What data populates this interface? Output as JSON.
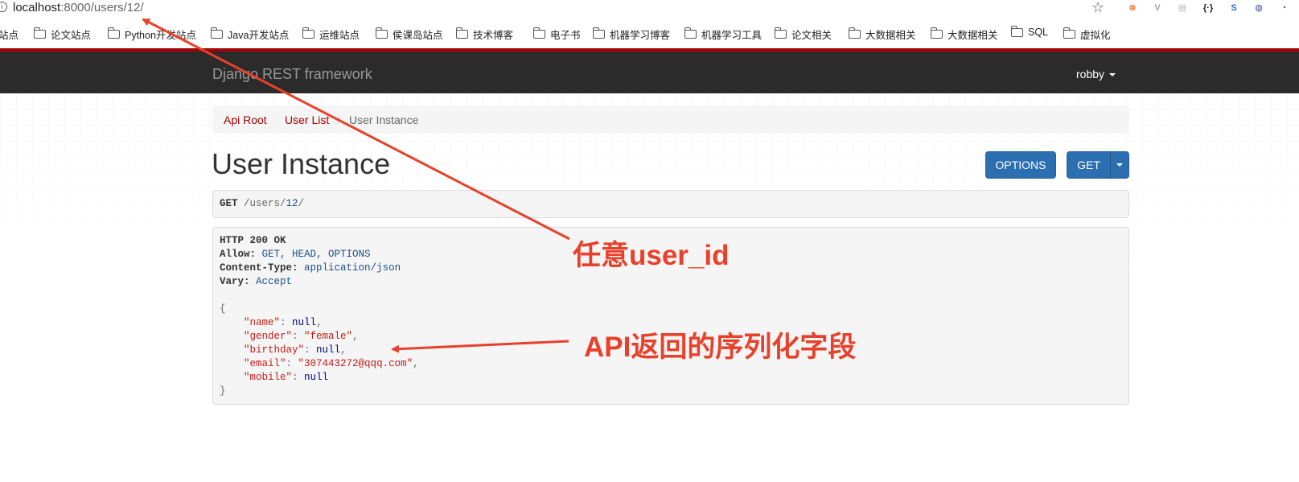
{
  "browser": {
    "url_host": "localhost",
    "url_rest": ":8000/users/12/",
    "info_icon": "i",
    "star_icon": "☆",
    "extensions": [
      {
        "name": "ext-orange-icon",
        "color": "#f26b21",
        "glyph": "⊗"
      },
      {
        "name": "ext-vue-icon",
        "color": "#9e9e9e",
        "glyph": "V"
      },
      {
        "name": "ext-grid-icon",
        "color": "#cccccc",
        "glyph": "▦"
      },
      {
        "name": "ext-json-icon",
        "color": "#222222",
        "glyph": "{·}"
      },
      {
        "name": "ext-s-icon",
        "color": "#2a6ebb",
        "glyph": "S"
      },
      {
        "name": "ext-globe-icon",
        "color": "#3b4aa8",
        "glyph": "◍"
      },
      {
        "name": "ext-chat-icon",
        "color": "#555555",
        "glyph": "◔"
      }
    ],
    "bookmarks": [
      "站点",
      "论文站点",
      "Python开发站点",
      "Java开发站点",
      "运维站点",
      "侯课岛站点",
      "技术博客",
      "电子书",
      "机器学习博客",
      "机器学习工具",
      "论文相关",
      "大数据相关",
      "大数据相关",
      "SQL",
      "虚拟化"
    ]
  },
  "navbar": {
    "brand": "Django REST framework",
    "user": "robby"
  },
  "breadcrumb": {
    "items": [
      "Api Root",
      "User List",
      "User Instance"
    ],
    "separator": "/"
  },
  "page": {
    "title": "User Instance"
  },
  "buttons": {
    "options": "OPTIONS",
    "get": "GET"
  },
  "request": {
    "method": "GET",
    "path_prefix": "/users/",
    "path_id": "12",
    "path_suffix": "/"
  },
  "response": {
    "status": "HTTP 200 OK",
    "headers": [
      {
        "key": "Allow:",
        "value": "GET, HEAD, OPTIONS"
      },
      {
        "key": "Content-Type:",
        "value": "application/json"
      },
      {
        "key": "Vary:",
        "value": "Accept"
      }
    ],
    "json_open": "{",
    "json_close": "}",
    "fields": [
      {
        "key": "\"name\"",
        "value": "null",
        "type": "null",
        "comma": ","
      },
      {
        "key": "\"gender\"",
        "value": "\"female\"",
        "type": "string",
        "comma": ","
      },
      {
        "key": "\"birthday\"",
        "value": "null",
        "type": "null",
        "comma": ","
      },
      {
        "key": "\"email\"",
        "value": "\"307443272@qqq.com\"",
        "type": "string",
        "comma": ","
      },
      {
        "key": "\"mobile\"",
        "value": "null",
        "type": "null",
        "comma": ""
      }
    ]
  },
  "annotations": {
    "user_id": "任意user_id",
    "fields": "API返回的序列化字段",
    "color": "#e8412b"
  }
}
